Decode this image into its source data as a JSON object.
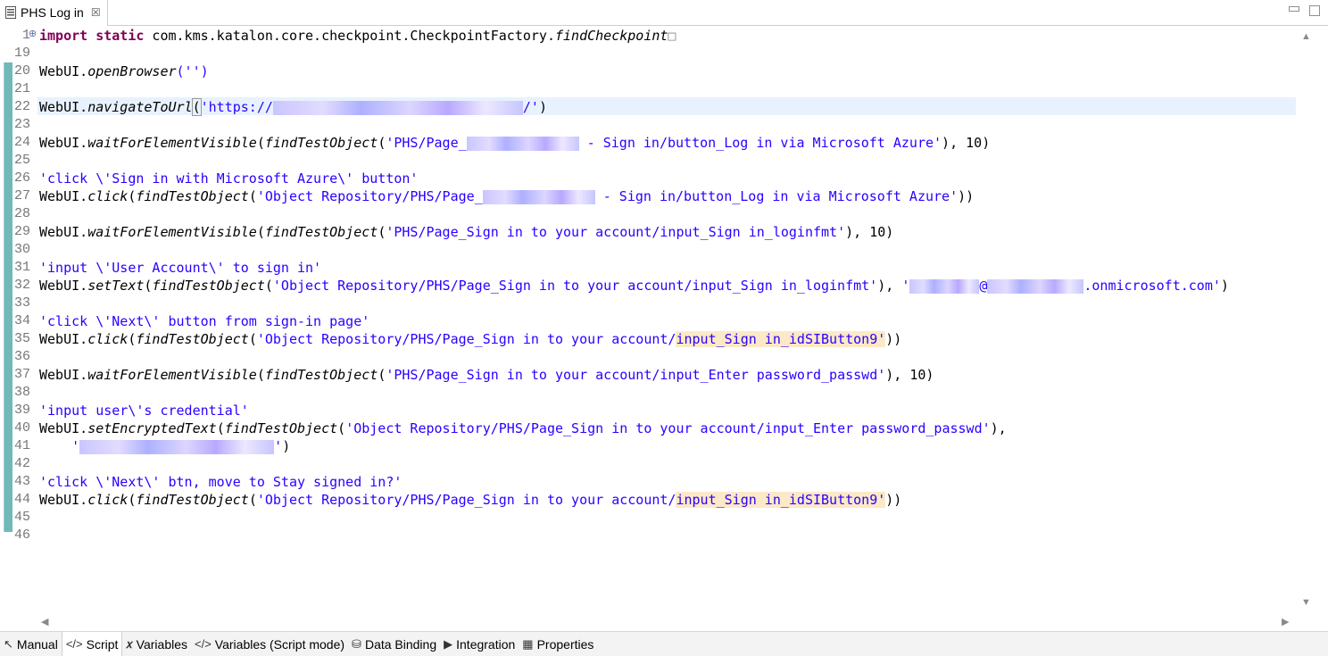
{
  "tab": {
    "title": "PHS Log in",
    "close": "☒"
  },
  "lines": [
    {
      "n": "1",
      "mark": "⊕"
    },
    {
      "n": "19"
    },
    {
      "n": "20"
    },
    {
      "n": "21"
    },
    {
      "n": "22"
    },
    {
      "n": "23"
    },
    {
      "n": "24"
    },
    {
      "n": "25"
    },
    {
      "n": "26"
    },
    {
      "n": "27"
    },
    {
      "n": "28"
    },
    {
      "n": "29"
    },
    {
      "n": "30"
    },
    {
      "n": "31"
    },
    {
      "n": "32"
    },
    {
      "n": "33"
    },
    {
      "n": "34"
    },
    {
      "n": "35"
    },
    {
      "n": "36"
    },
    {
      "n": "37"
    },
    {
      "n": "38"
    },
    {
      "n": "39"
    },
    {
      "n": "40"
    },
    {
      "n": "41"
    },
    {
      "n": "42"
    },
    {
      "n": "43"
    },
    {
      "n": "44"
    },
    {
      "n": "45"
    },
    {
      "n": "46"
    }
  ],
  "code": {
    "l1": {
      "kw1": "import",
      "kw2": "static",
      "rest": " com.kms.katalon.core.checkpoint.CheckpointFactory.",
      "fn": "findCheckpoint",
      "fold": "□"
    },
    "l20": {
      "obj": "WebUI.",
      "fn": "openBrowser",
      "args": "('')"
    },
    "l22": {
      "obj": "WebUI.",
      "fn": "navigateToUrl",
      "paren": "(",
      "s1": "'https://",
      "s2": "/'",
      "end": ")"
    },
    "l24": {
      "obj": "WebUI.",
      "fn": "waitForElementVisible",
      "p1": "(",
      "fn2": "findTestObject",
      "p2": "(",
      "s1": "'PHS/Page_",
      "s2": " - Sign in/button_Log in via Microsoft Azure'",
      "end": "), 10)"
    },
    "l26": {
      "s": "'click \\'Sign in with Microsoft Azure\\' button'"
    },
    "l27": {
      "obj": "WebUI.",
      "fn": "click",
      "p1": "(",
      "fn2": "findTestObject",
      "p2": "(",
      "s1": "'Object Repository/PHS/Page_",
      "s2": " - Sign in/button_Log in via Microsoft Azure'",
      "end": "))"
    },
    "l29": {
      "obj": "WebUI.",
      "fn": "waitForElementVisible",
      "p1": "(",
      "fn2": "findTestObject",
      "p2": "(",
      "s": "'PHS/Page_Sign in to your account/input_Sign in_loginfmt'",
      "end": "), 10)"
    },
    "l31": {
      "s": "'input \\'User Account\\' to sign in'"
    },
    "l32": {
      "obj": "WebUI.",
      "fn": "setText",
      "p1": "(",
      "fn2": "findTestObject",
      "p2": "(",
      "s": "'Object Repository/PHS/Page_Sign in to your account/input_Sign in_loginfmt'",
      "mid": "), ",
      "q": "'",
      "at": "@",
      "dom": ".onmicrosoft.com'",
      "end": ")"
    },
    "l34": {
      "s": "'click \\'Next\\' button from sign-in page'"
    },
    "l35": {
      "obj": "WebUI.",
      "fn": "click",
      "p1": "(",
      "fn2": "findTestObject",
      "p2": "(",
      "s1": "'Object Repository/PHS/Page_Sign in to your account/",
      "s2": "input_Sign in_idSIButton9'",
      "end": "))"
    },
    "l37": {
      "obj": "WebUI.",
      "fn": "waitForElementVisible",
      "p1": "(",
      "fn2": "findTestObject",
      "p2": "(",
      "s": "'PHS/Page_Sign in to your account/input_Enter password_passwd'",
      "end": "), 10)"
    },
    "l39": {
      "s": "'input user\\'s credential'"
    },
    "l40": {
      "obj": "WebUI.",
      "fn": "setEncryptedText",
      "p1": "(",
      "fn2": "findTestObject",
      "p2": "(",
      "s": "'Object Repository/PHS/Page_Sign in to your account/input_Enter password_passwd'",
      "end": "),"
    },
    "l41": {
      "indent": "    ",
      "q1": "'",
      "q2": "'",
      "end": ")"
    },
    "l43": {
      "s": "'click \\'Next\\' btn, move to Stay signed in?'"
    },
    "l44": {
      "obj": "WebUI.",
      "fn": "click",
      "p1": "(",
      "fn2": "findTestObject",
      "p2": "(",
      "s1": "'Object Repository/PHS/Page_Sign in to your account/",
      "s2": "input_Sign in_idSIButton9'",
      "end": "))"
    }
  },
  "scroll": {
    "up": "▲",
    "down": "▼",
    "left": "◀",
    "right": "▶"
  },
  "bottom_tabs": [
    {
      "label": "Manual",
      "icon": "↖"
    },
    {
      "label": "Script",
      "icon": "</>"
    },
    {
      "label": "Variables",
      "icon": "𝑥"
    },
    {
      "label": "Variables (Script mode)",
      "icon": "</>"
    },
    {
      "label": "Data Binding",
      "icon": "⛁"
    },
    {
      "label": "Integration",
      "icon": "▶"
    },
    {
      "label": "Properties",
      "icon": "▦"
    }
  ]
}
